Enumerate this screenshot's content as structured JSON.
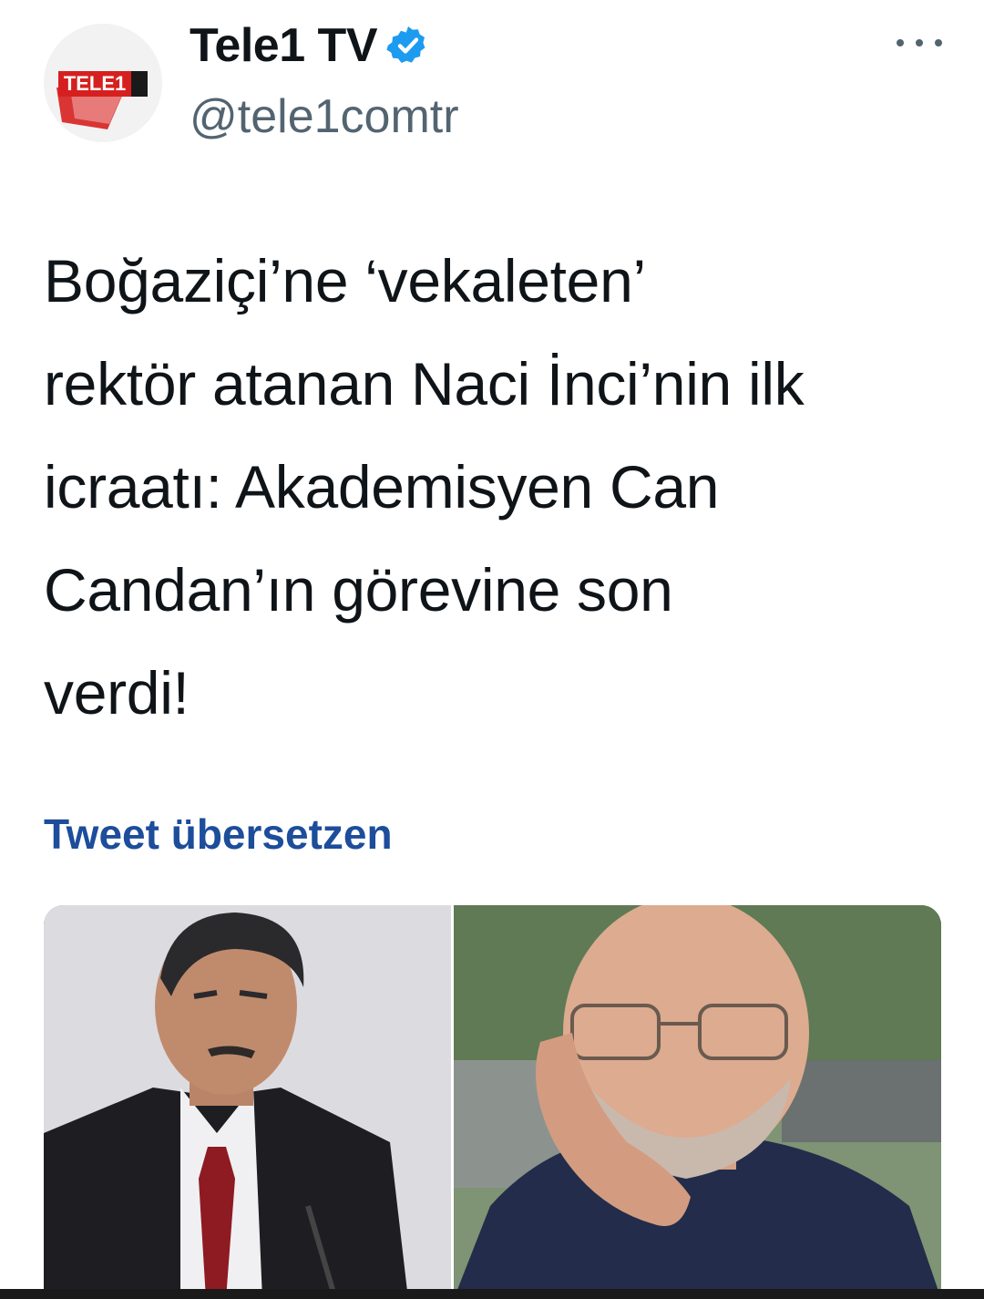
{
  "tweet": {
    "author": {
      "display_name": "Tele1 TV",
      "handle": "@tele1comtr",
      "verified": true,
      "avatar_logo_text": "TELE1",
      "verified_icon": "verified-badge-icon"
    },
    "more_icon": "more-horizontal-icon",
    "text": "Boğaziçi’ne ‘vekaleten’\nrektör atanan Naci İnci’nin ilk\nicraatı: Akademisyen Can\nCandan’ın görevine son\nverdi!",
    "translate_label": "Tweet übersetzen",
    "media": {
      "photos": 2
    }
  },
  "colors": {
    "text": "#0f1419",
    "secondary": "#536471",
    "link": "#1d4d9b",
    "verified": "#1d9bf0",
    "logo_red": "#d6201f"
  }
}
